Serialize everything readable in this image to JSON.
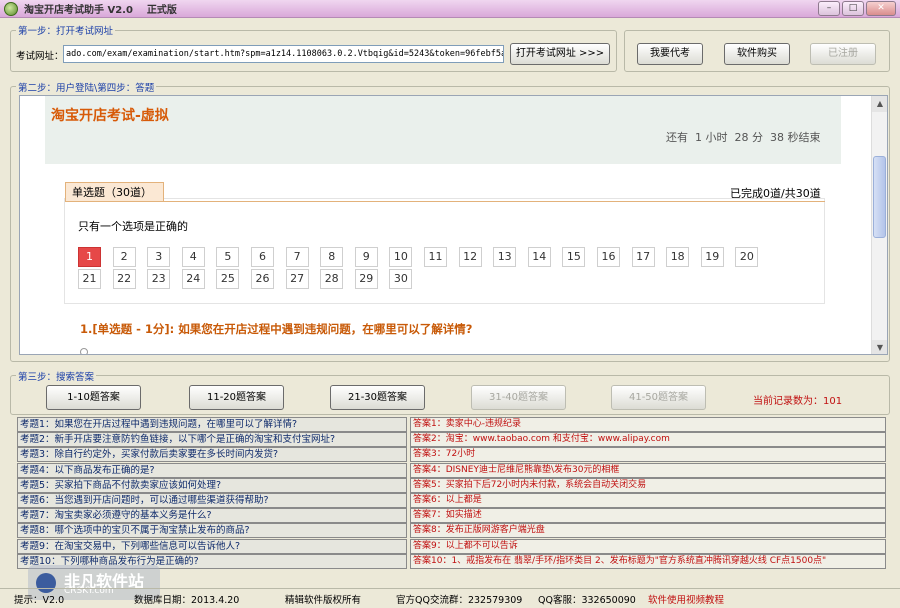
{
  "window": {
    "title": "淘宝开店考试助手 V2.0    正式版",
    "btn_min": "–",
    "btn_max": "□",
    "btn_close": "✕"
  },
  "step1": {
    "label": "第一步：打开考试网址",
    "url_label": "考试网址：",
    "url_value": "ado.com/exam/examination/start.htm?spm=a1z14.1108063.0.2.Vtbqig&id=5243&token=96febf5a",
    "open_button": "打开考试网址 >>>"
  },
  "actions": {
    "proxy": "我要代考",
    "buy": "软件购买",
    "registered": "已注册"
  },
  "step2": {
    "label": "第二步：用户登陆\\第四步：答题"
  },
  "exam": {
    "title": "淘宝开店考试-虚拟",
    "timer": "还有  1 小时  28 分  38 秒结束",
    "tab": "单选题（30道）",
    "progress": "已完成0道/共30道",
    "instruction": "只有一个选项是正确的",
    "numbers_row1": [
      "1",
      "2",
      "3",
      "4",
      "5",
      "6",
      "7",
      "8",
      "9",
      "10",
      "11",
      "12",
      "13",
      "14",
      "15",
      "16",
      "17",
      "18",
      "19",
      "20"
    ],
    "numbers_row2": [
      "21",
      "22",
      "23",
      "24",
      "25",
      "26",
      "27",
      "28",
      "29",
      "30"
    ],
    "current": "1",
    "question": "1.[单选题 - 1分]: 如果您在开店过程中遇到违规问题，在哪里可以了解详情?"
  },
  "step3": {
    "label": "第三步：搜索答案",
    "buttons": [
      "1-10题答案",
      "11-20题答案",
      "21-30题答案",
      "31-40题答案",
      "41-50题答案"
    ],
    "record_count": "当前记录数为：101"
  },
  "table": {
    "rows": [
      {
        "q": "考题1：如果您在开店过程中遇到违规问题，在哪里可以了解详情?",
        "a": "答案1：卖家中心-违规纪录"
      },
      {
        "q": "考题2：新手开店要注意防钓鱼链接，以下哪个是正确的淘宝和支付宝网址?",
        "a": "答案2：淘宝：www.taobao.com 和支付宝：www.alipay.com"
      },
      {
        "q": "考题3：除自行约定外，买家付款后卖家要在多长时间内发货?",
        "a": "答案3：72小时"
      },
      {
        "q": "考题4：以下商品发布正确的是?",
        "a": "答案4：DISNEY迪士尼维尼熊靠垫\\发布30元的相框"
      },
      {
        "q": "考题5：买家拍下商品不付款卖家应该如何处理?",
        "a": "答案5：买家拍下后72小时内未付款，系统会自动关闭交易"
      },
      {
        "q": "考题6：当您遇到开店问题时，可以通过哪些渠道获得帮助?",
        "a": "答案6：以上都是"
      },
      {
        "q": "考题7：淘宝卖家必须遵守的基本义务是什么?",
        "a": "答案7：如实描述"
      },
      {
        "q": "考题8：哪个选项中的宝贝不属于淘宝禁止发布的商品?",
        "a": "答案8：发布正版网游客户端光盘"
      },
      {
        "q": "考题9：在淘宝交易中，下列哪些信息可以告诉他人?",
        "a": "答案9：以上都不可以告诉"
      },
      {
        "q": "考题10：下列哪种商品发布行为是正确的?",
        "a": "答案10：1、戒指发布在 翡翠/手环/指环类目  2、发布标题为\"官方系统直冲腾讯穿越火线 CF点1500点\""
      }
    ]
  },
  "status": {
    "s1": "提示：V2.0",
    "s2": "数据库日期：2013.4.20",
    "s3": "精辑软件版权所有",
    "s4": "官方QQ交流群：232579309",
    "s5": "QQ客服：332650090",
    "s6": "软件使用视频教程"
  },
  "watermark": {
    "text": "非凡软件站",
    "url": "CRSKY.com"
  }
}
